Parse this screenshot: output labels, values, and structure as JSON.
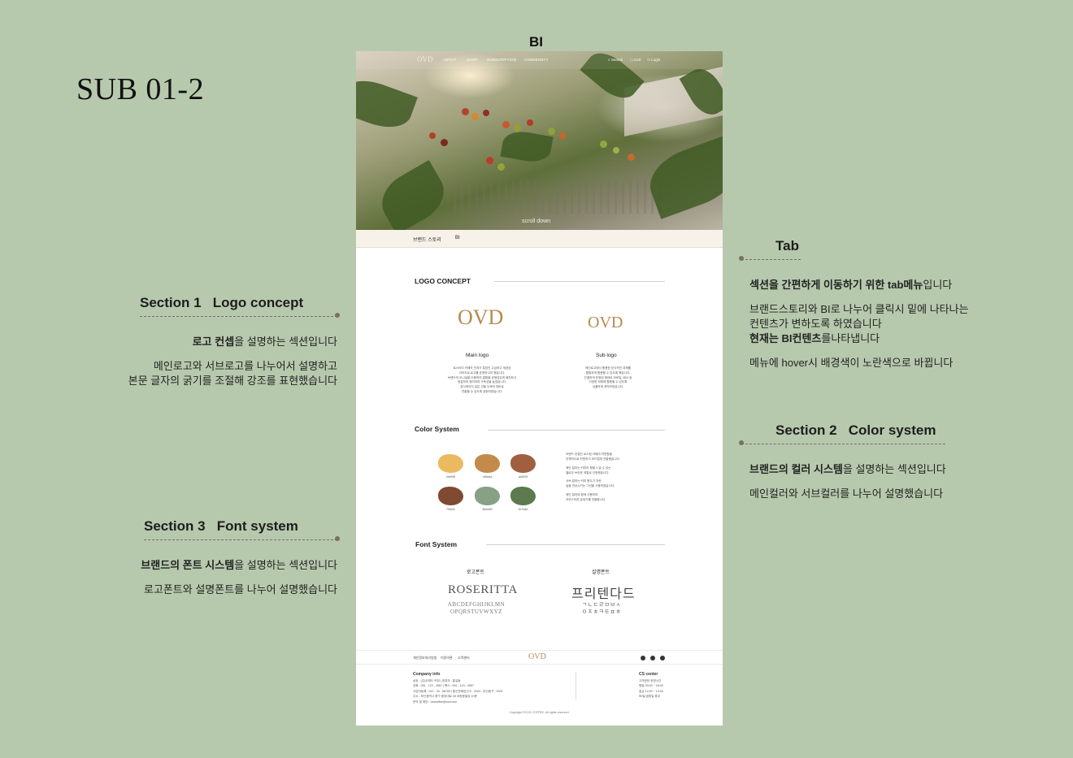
{
  "page_title": "SUB 01-2",
  "mockup_title": "BI",
  "annotations": {
    "tab": {
      "title": "Tab",
      "lines_plain": [
        "메뉴에 hover시 배경색이 노란색으로 바뀝니다"
      ],
      "line1_bold": "섹션을 간편하게 이동하기 위한 tab메뉴",
      "line1_rest": "입니다",
      "line2a": "브랜드스토리와 BI로 나누어 클릭시 밑에 나타나는",
      "line2b": "컨텐츠가 변하도록 하였습니다",
      "line2c_bold": "현재는 BI컨텐츠",
      "line2c_rest": "를나타냅니다",
      "line3": "메뉴에 hover시 배경색이 노란색으로 바뀝니다"
    },
    "section1": {
      "title": "Section 1   Logo concept",
      "line1_bold": "로고 컨셉",
      "line1_rest": "을 설명하는 섹션입니다",
      "line2a": "메인로고와 서브로고를 나누어서 설명하고",
      "line2b": "본문 글자의 굵기를 조절해 강조를 표현했습니다"
    },
    "section2": {
      "title": "Section 2   Color system",
      "line1_bold": "브랜드의 컬러 시스템",
      "line1_rest": "을 설명하는 섹션입니다",
      "line2": "메인컬러와 서브컬러를 나누어 설명했습니다"
    },
    "section3": {
      "title": "Section 3   Font system",
      "line1_bold": "브랜드의 폰트 시스템",
      "line1_rest": "을 설명하는 섹션입니다",
      "line2": "로고폰트와 설명폰트를 나누어 설명했습니다"
    }
  },
  "site": {
    "nav": {
      "logo": "OVD",
      "menu": [
        "ABOUT",
        "SHOP",
        "SUBSCRIPTION",
        "COMMUNITY"
      ],
      "search": "Search",
      "cart": "Cart",
      "login": "Login"
    },
    "hero": {
      "scroll_hint": "scroll down"
    },
    "tabs": [
      "브랜드 스토리",
      "BI"
    ],
    "logo_concept": {
      "heading": "LOGO CONCEPT",
      "main": {
        "mark": "OVD",
        "caption": "Main logo",
        "text": [
          "로스터리 카페의 전개가 특징인 고급하고 세련된",
          "이미지로 로고를 표현하고자 했습니다.",
          "",
          "브랜드의 이니셜을 이용하여 결합을 균형감있게 배치하고",
          "정갈하게 정리하여 가독성을 높였습니다.",
          "",
          "장식적이지 않은 선을 두께의 대비로",
          "연출할 수 있도록 표현하였습니다."
        ]
      },
      "sub": {
        "mark": "OVD",
        "caption": "Sub logo",
        "text": [
          "메인로고에서 활용한 장식적인 대체를",
          "활발하게 활용할 수 있도록 했습니다.",
          "",
          "간결하게 표현된 형태로 모바일, 배너 등",
          "다양한 매체에 활용할 수 있도록",
          "심플하게 제작하였습니다."
        ]
      }
    },
    "color_system": {
      "heading": "Color System",
      "swatches": [
        {
          "hex": "#ebb95f",
          "label": "ebb95f"
        },
        {
          "hex": "#c48a4a",
          "label": "c48a4a"
        },
        {
          "hex": "#a0603f",
          "label": "a0603f"
        },
        {
          "hex": "#7f4a31",
          "label": "7f4a31"
        },
        {
          "hex": "#86a185",
          "label": "86a185"
        },
        {
          "hex": "#5c7a4d",
          "label": "5c7a4d"
        }
      ],
      "text": [
        "브랜드 컨셉인 로스팅 카페의 따뜻함을",
        "전체적으로 따뜻하고 부드럽게 연출했습니다.",
        "",
        "메인 컬러는 커피의 향을 느낄 수 있는",
        "옐로우 브라운 계열로 선정했습니다.",
        "",
        "서브 컬러는 커피 원두가 자란",
        "숲을 연상시키는 그린을 사용하였습니다.",
        "",
        "메인 컬러와 함께 사용하여",
        "자연스러운 분위기를 연출합니다."
      ]
    },
    "font_system": {
      "heading": "Font System",
      "logo_font": {
        "caption": "로고폰트",
        "name": "ROSERITTA",
        "alphabet1": "ABCDEFGHIJKLMN",
        "alphabet2": "OPQRSTUVWXYZ"
      },
      "body_font": {
        "caption": "설명폰트",
        "name": "프리텐다드",
        "alphabet1": "ㄱㄴㄷㄹㅁㅂㅅ",
        "alphabet2": "ㅇㅈㅊㅋㅌㅍㅎ"
      }
    },
    "footer": {
      "links": [
        "개인정보처리방침",
        "이용약관",
        "고객센터"
      ],
      "logo": "OVD",
      "company_head": "Company info",
      "company_lines": [
        "상호 : (주)오래드 커피  |  대표자 : 홍길동",
        "전화 : 051 - 123 - 4567  |  팩스 : 051 - 123 - 4567",
        "사업자등록 : 012 - 34 - 56789  |  통신판매업신고 : 2024 - 부산중구 - 0001",
        "주소 : 부산광역시 중구 중앙대로 26 대청동빌딩 10층",
        "문의 및 제안 : ovdcoffee@ovd.com"
      ],
      "cs_head": "CS center",
      "cs_lines": [
        "고객센터 운영시간",
        "평일 09:00 ~ 18:00",
        "점심 12:00 ~ 13:00",
        "토/일/공휴일 휴무"
      ],
      "copyright": "Copyright ©OVD COFFEE. All rights reserved."
    }
  }
}
